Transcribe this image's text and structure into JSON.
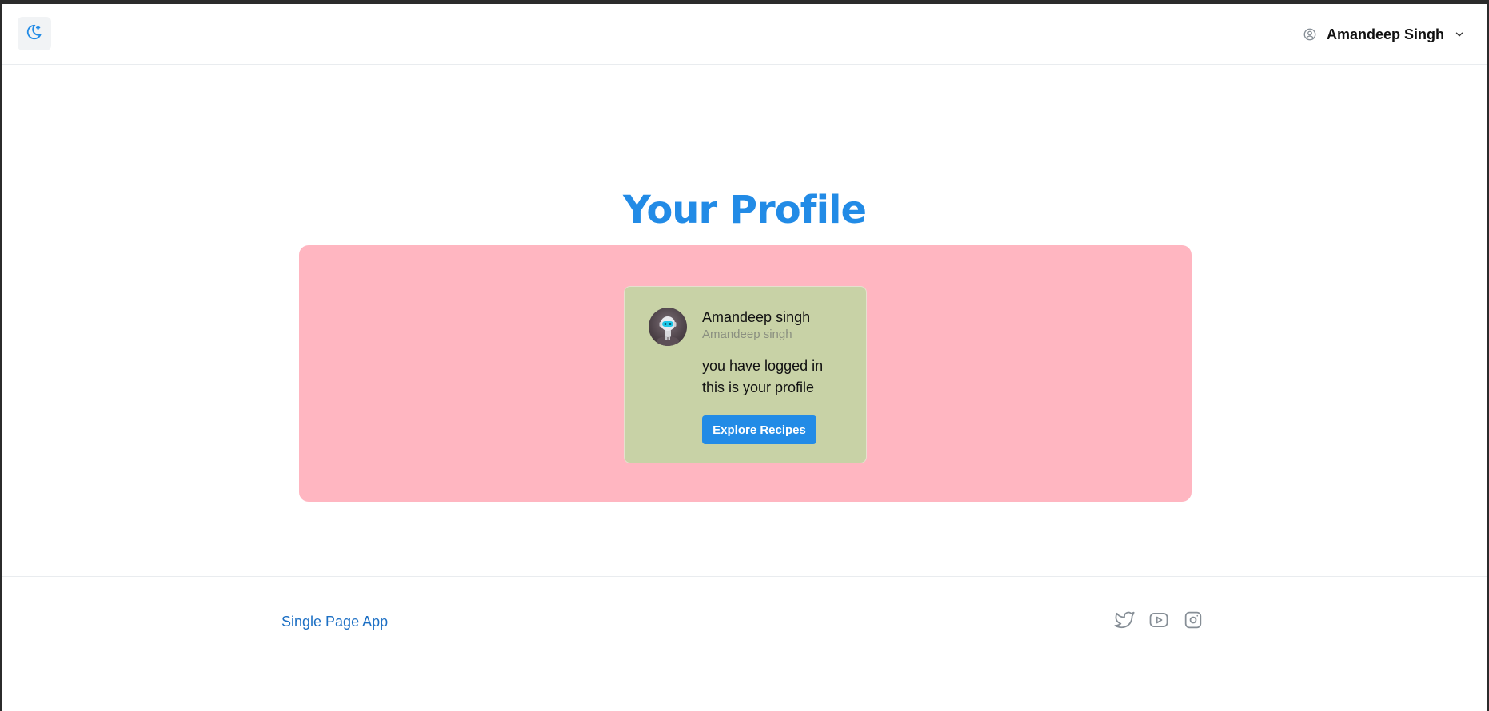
{
  "header": {
    "theme_toggle_icon": "moon-icon",
    "user": {
      "icon": "user-circle-icon",
      "name": "Amandeep Singh",
      "chevron_icon": "chevron-down-icon"
    }
  },
  "main": {
    "title": "Your Profile",
    "card": {
      "avatar": "robot-avatar",
      "name": "Amandeep singh",
      "username": "Amandeep singh",
      "message": "you have logged in this is your profile",
      "button_label": "Explore Recipes"
    }
  },
  "footer": {
    "brand_link": "Single Page App",
    "social_icons": [
      "twitter-icon",
      "youtube-icon",
      "instagram-icon"
    ]
  },
  "colors": {
    "accent": "#228be6",
    "panel": "#ffb6c1",
    "card": "#c8d2a6"
  }
}
